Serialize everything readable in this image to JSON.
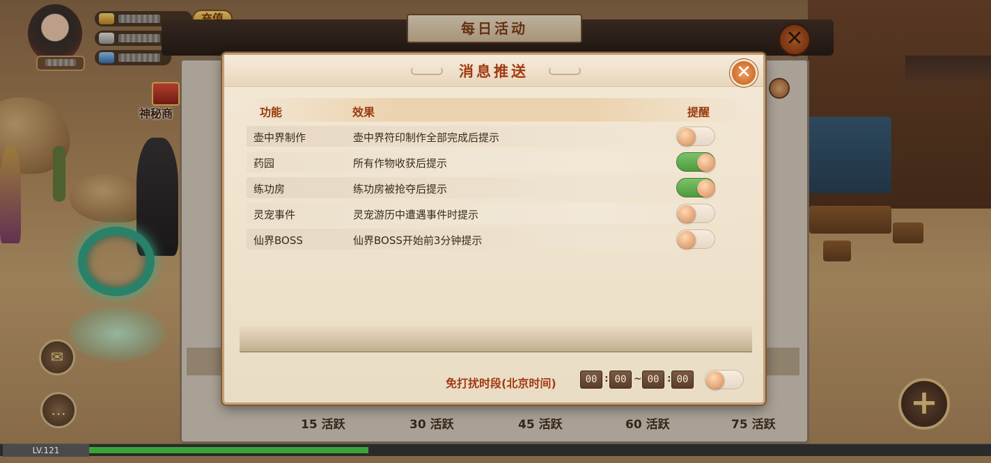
{
  "hud": {
    "recharge_label": "充值",
    "mystery_label": "神秘商",
    "level_label": "LV.121",
    "xp_fraction": 0.31
  },
  "daily": {
    "title": "每日活动",
    "close_glyph": "✕",
    "activity_milestones": [
      "15 活跃",
      "30 活跃",
      "45 活跃",
      "60 活跃",
      "75 活跃"
    ]
  },
  "dialog": {
    "title": "消息推送",
    "close_glyph": "✕",
    "columns": {
      "function": "功能",
      "effect": "效果",
      "remind": "提醒"
    },
    "rows": [
      {
        "function": "壶中界制作",
        "effect": "壶中界符印制作全部完成后提示",
        "enabled": false
      },
      {
        "function": "药园",
        "effect": "所有作物收获后提示",
        "enabled": true
      },
      {
        "function": "练功房",
        "effect": "练功房被抢夺后提示",
        "enabled": true
      },
      {
        "function": "灵宠事件",
        "effect": "灵宠游历中遭遇事件时提示",
        "enabled": false
      },
      {
        "function": "仙界BOSS",
        "effect": "仙界BOSS开始前3分钟提示",
        "enabled": false
      }
    ],
    "dnd": {
      "label": "免打扰时段(北京时间)",
      "start_hour": "00",
      "start_minute": "00",
      "end_hour": "00",
      "end_minute": "00",
      "colon": ":",
      "range_sep": "~",
      "enabled": false
    }
  },
  "colors": {
    "accent_text": "#a23a10",
    "toggle_on": "#4f9a3e",
    "panel_bg": "#efe2cc"
  }
}
